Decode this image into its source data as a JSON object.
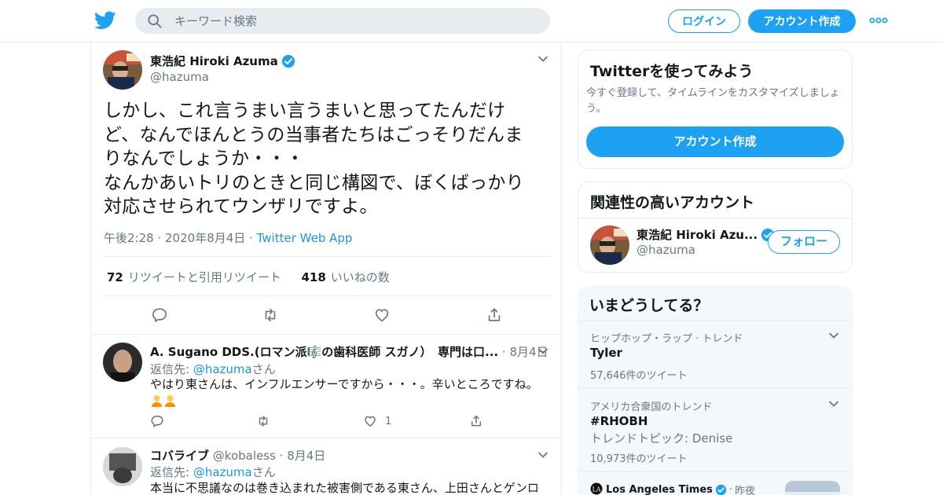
{
  "header": {
    "search_placeholder": "キーワード検索",
    "login_label": "ログイン",
    "signup_label": "アカウント作成"
  },
  "tweet": {
    "display_name": "東浩紀 Hiroki Azuma",
    "handle": "@hazuma",
    "text": "しかし、これ言うまい言うまいと思ってたんだけ\nど、なんでほんとうの当事者たちはごっそりだんま\nりなんでしょうか・・・\nなんかあいトリのときと同じ構図で、ぼくばっかり\n対応させられてウンザリですよ。",
    "time": "午後2:28",
    "date": "2020年8月4日",
    "source": "Twitter Web App",
    "retweet_count": "72",
    "retweet_label": "リツイートと引用リツイート",
    "like_count": "418",
    "like_label": "いいねの数"
  },
  "replies": [
    {
      "name": "A. Sugano DDS.(ロマン派🎼の歯科医師 スガノ）　専門は口...",
      "handle": "",
      "date": "8月4日",
      "reply_prefix": "返信先: ",
      "reply_to": "@hazuma",
      "reply_suffix": "さん",
      "text": "やはり東さんは、インフルエンサーですから・・・。辛いところですね。",
      "like_count": "1"
    },
    {
      "name": "コバライブ",
      "handle": "@kobaless",
      "date": "8月4日",
      "reply_prefix": "返信先: ",
      "reply_to": "@hazuma",
      "reply_suffix": "さん",
      "text": "本当に不思議なのは巻き込まれた被害側である東さん、上田さんとゲンロ"
    }
  ],
  "sidebar": {
    "try_title": "Twitterを使ってみよう",
    "try_desc_line1": "今すぐ登録して、タイムラインをカスタマイズしましょ",
    "try_desc_line2": "う。",
    "try_button": "アカウント作成",
    "related_title": "関連性の高いアカウント",
    "related_name": "東浩紀 Hiroki Azu...",
    "related_handle": "@hazuma",
    "follow_label": "フォロー",
    "trends_title": "いまどうしてる？",
    "trends": [
      {
        "context": "ヒップホップ・ラップ · トレンド",
        "name": "Tyler",
        "count": "57,646件のツイート"
      },
      {
        "context": "アメリカ合衆国のトレンド",
        "name": "#RHOBH",
        "sub": "トレンドトピック: Denise",
        "count": "10,973件のツイート"
      }
    ],
    "news_source": "Los Angeles Times",
    "news_time": "昨夜"
  },
  "colors": {
    "accent": "#1da1f2",
    "text": "#14171a",
    "muted": "#657786",
    "border": "#e6ecf0"
  }
}
